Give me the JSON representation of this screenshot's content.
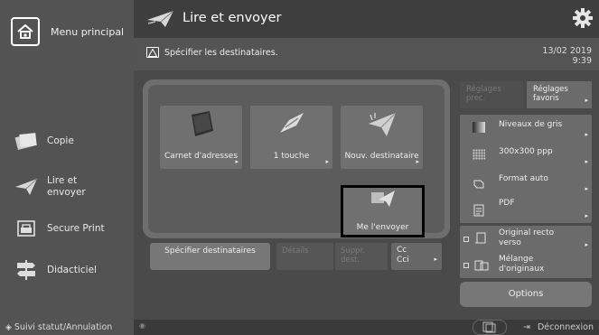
{
  "sidebar": {
    "home_label": "Menu principal",
    "items": [
      {
        "label": "Copie",
        "icon": "copy-icon"
      },
      {
        "label": "Lire et envoyer",
        "icon": "scan-send-icon"
      },
      {
        "label": "Secure Print",
        "icon": "secure-print-icon"
      },
      {
        "label": "Didacticiel",
        "icon": "tutorial-icon"
      }
    ],
    "status_label": "Suivi statut/Annulation"
  },
  "header": {
    "title": "Lire et envoyer",
    "settings_icon": "gear-icon"
  },
  "message_bar": {
    "text": "Spécifier les destinataires.",
    "date": "13/02 2019",
    "time": "9:39"
  },
  "destinations": {
    "tiles": [
      {
        "label": "Carnet d'adresses"
      },
      {
        "label": "1 touche"
      },
      {
        "label": "Nouv. destinataire"
      },
      {
        "label": "Me l'envoyer"
      }
    ],
    "specify_button": "Spécifier destinataires",
    "details_button": "Détails",
    "delete_button": "Suppr. dest.",
    "cc_button": "Cc Cci"
  },
  "settings": {
    "tabs": [
      "Réglages prec.",
      "Réglages favoris"
    ],
    "rows": [
      {
        "label": "Niveaux de gris"
      },
      {
        "label": "300x300 ppp"
      },
      {
        "label": "Format auto"
      },
      {
        "label": "PDF"
      },
      {
        "label": "Original recto verso"
      },
      {
        "label": "Mélange d'originaux"
      }
    ],
    "options_button": "Options"
  },
  "footer": {
    "logout_label": "Déconnexion"
  },
  "colors": {
    "highlight": "#000000",
    "background": "#3f3f3f"
  }
}
